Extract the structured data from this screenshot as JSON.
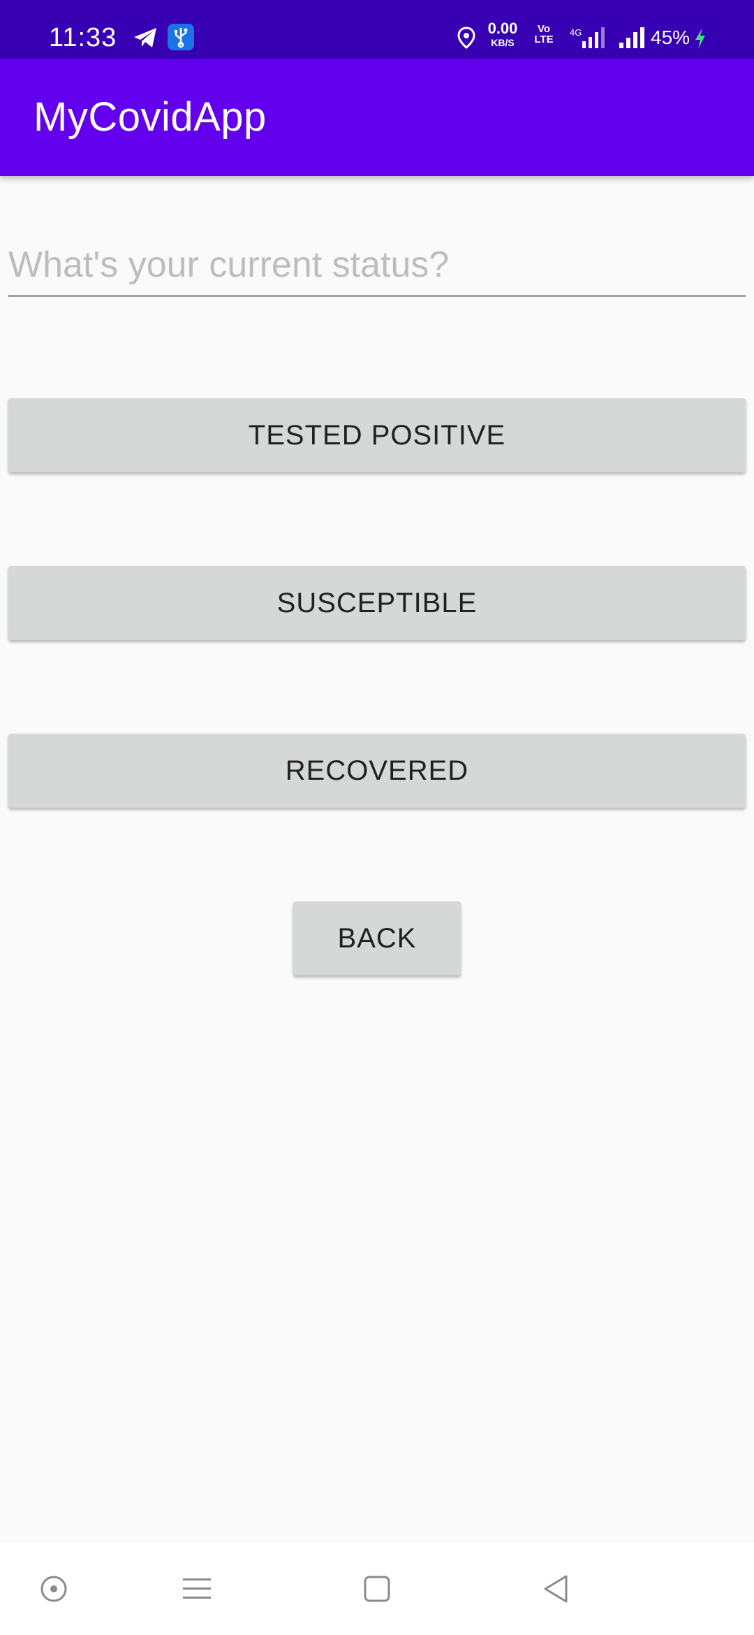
{
  "status_bar": {
    "time": "11:33",
    "net_speed_value": "0.00",
    "net_speed_unit": "KB/S",
    "volte_top": "Vo",
    "volte_bottom": "LTE",
    "battery": "45%",
    "icons": [
      "telegram-icon",
      "usb-icon",
      "location-icon",
      "signal-4g-icon",
      "signal-icon",
      "charging-icon"
    ]
  },
  "app_bar": {
    "title": "MyCovidApp",
    "color": "#6200ee"
  },
  "status_input": {
    "value": "",
    "placeholder": "What's your current status?"
  },
  "buttons": {
    "tested_positive": "TESTED POSITIVE",
    "susceptible": "SUSCEPTIBLE",
    "recovered": "RECOVERED",
    "back": "BACK"
  },
  "nav_bar": {
    "icons": [
      "assistant-icon",
      "recents-icon",
      "home-icon",
      "back-icon"
    ]
  }
}
